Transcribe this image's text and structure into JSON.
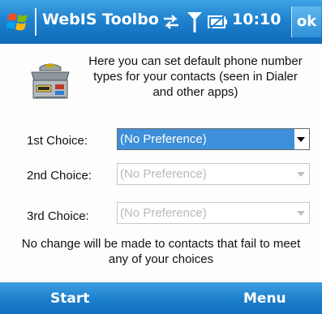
{
  "title_bar": {
    "app_title": "WebIS Toolbo",
    "clock": "10:10",
    "ok_label": "ok",
    "icons": [
      "windows-start-flag-icon",
      "connectivity-arrows-icon",
      "signal-antenna-icon",
      "battery-icon"
    ]
  },
  "intro": {
    "icon": "toolbox-icon",
    "text": "Here you can set default phone number types for your contacts (seen in Dialer and other apps)"
  },
  "choices": [
    {
      "label": "1st Choice:",
      "value": "(No Preference)",
      "state": "selected"
    },
    {
      "label": "2nd Choice:",
      "value": "(No Preference)",
      "state": "disabled"
    },
    {
      "label": "3rd Choice:",
      "value": "(No Preference)",
      "state": "disabled"
    }
  ],
  "note": "No change will be made to contacts that fail to meet any of your choices",
  "soft_keys": {
    "left": "Start",
    "right": "Menu"
  },
  "colors": {
    "title_bar": "#1f82cf",
    "selection": "#3d8fd9",
    "disabled_text": "#b9b9b9"
  }
}
